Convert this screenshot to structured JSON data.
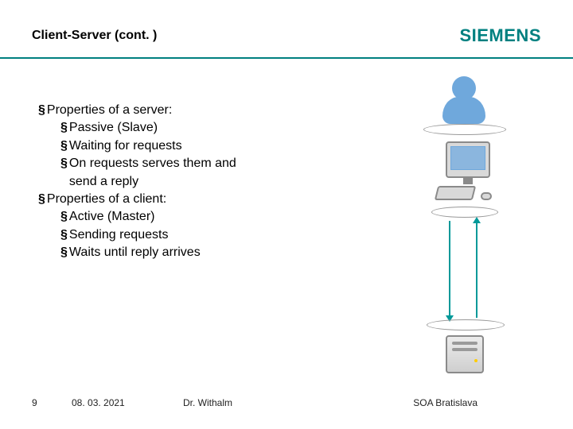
{
  "header": {
    "title": "Client-Server (cont. )",
    "logo": "SIEMENS"
  },
  "content": {
    "server_heading": "Properties of a server:",
    "server_items": {
      "i1": "Passive (Slave)",
      "i2": "Waiting for requests",
      "i3": "On requests serves them and send a reply"
    },
    "client_heading": "Properties of a client:",
    "client_items": {
      "i1": "Active (Master)",
      "i2": "Sending requests",
      "i3": "Waits until reply arrives"
    }
  },
  "footer": {
    "page": "9",
    "date": "08. 03. 2021",
    "author": "Dr. Withalm",
    "location": "SOA Bratislava"
  },
  "bullet": "§"
}
